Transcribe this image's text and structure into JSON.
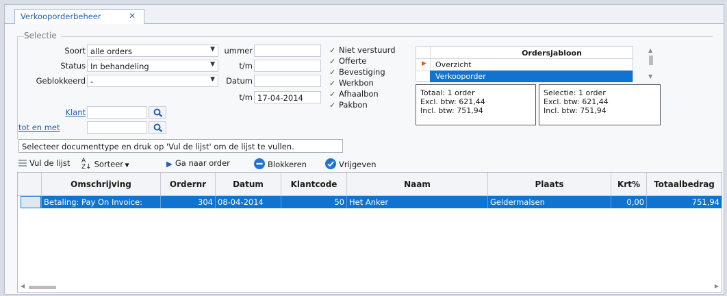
{
  "tab": {
    "title": "Verkooporderbeheer",
    "close": "✕"
  },
  "selectie": {
    "title": "Selectie",
    "soort_label": "Soort",
    "soort_value": "alle orders",
    "status_label": "Status",
    "status_value": "In behandeling",
    "geblokkeerd_label": "Geblokkeerd",
    "geblokkeerd_value": "-",
    "ordernummer_label": "ummer",
    "ordernummer_value": "",
    "tm1_label": "t/m",
    "tm1_value": "",
    "datum_label": "Datum",
    "datum_value": "",
    "tm2_label": "t/m",
    "tm2_value": "17-04-2014",
    "klant_label": "Klant",
    "klant_value": "",
    "totenmet_label": "tot en met",
    "totenmet_value": ""
  },
  "checks": [
    {
      "label": "Niet verstuurd",
      "checked": true
    },
    {
      "label": "Offerte",
      "checked": true
    },
    {
      "label": "Bevestiging",
      "checked": true
    },
    {
      "label": "Werkbon",
      "checked": true
    },
    {
      "label": "Afhaalbon",
      "checked": true
    },
    {
      "label": "Pakbon",
      "checked": true
    }
  ],
  "ordersjabloon": {
    "header": "Ordersjabloon",
    "rows": [
      "Overzicht",
      "Verkooporder"
    ],
    "selected": "Verkooporder"
  },
  "totaal": {
    "line1": "Totaal: 1 order",
    "line2": "Excl. btw: 621,44",
    "line3": "Incl. btw: 751,94"
  },
  "selectietot": {
    "line1": "Selectie: 1 order",
    "line2": "Excl. btw: 621,44",
    "line3": "Incl. btw: 751,94"
  },
  "hint": "Selecteer documenttype en druk op 'Vul de lijst' om de lijst te vullen.",
  "toolbar": {
    "vul": "Vul de lijst",
    "sorteer": "Sorteer",
    "ganaar": "Ga naar order",
    "blokkeren": "Blokkeren",
    "vrijgeven": "Vrijgeven"
  },
  "grid": {
    "headers": [
      "Omschrijving",
      "Ordernr",
      "Datum",
      "Klantcode",
      "Naam",
      "Plaats",
      "Krt%",
      "Totaalbedrag"
    ],
    "rows": [
      [
        "Betaling: Pay On Invoice:",
        "304",
        "08-04-2014",
        "50",
        "Het Anker",
        "Geldermalsen",
        "0,00",
        "751,94"
      ]
    ]
  },
  "colors": {
    "accent": "#0f73cf",
    "link": "#1d5fb0"
  }
}
